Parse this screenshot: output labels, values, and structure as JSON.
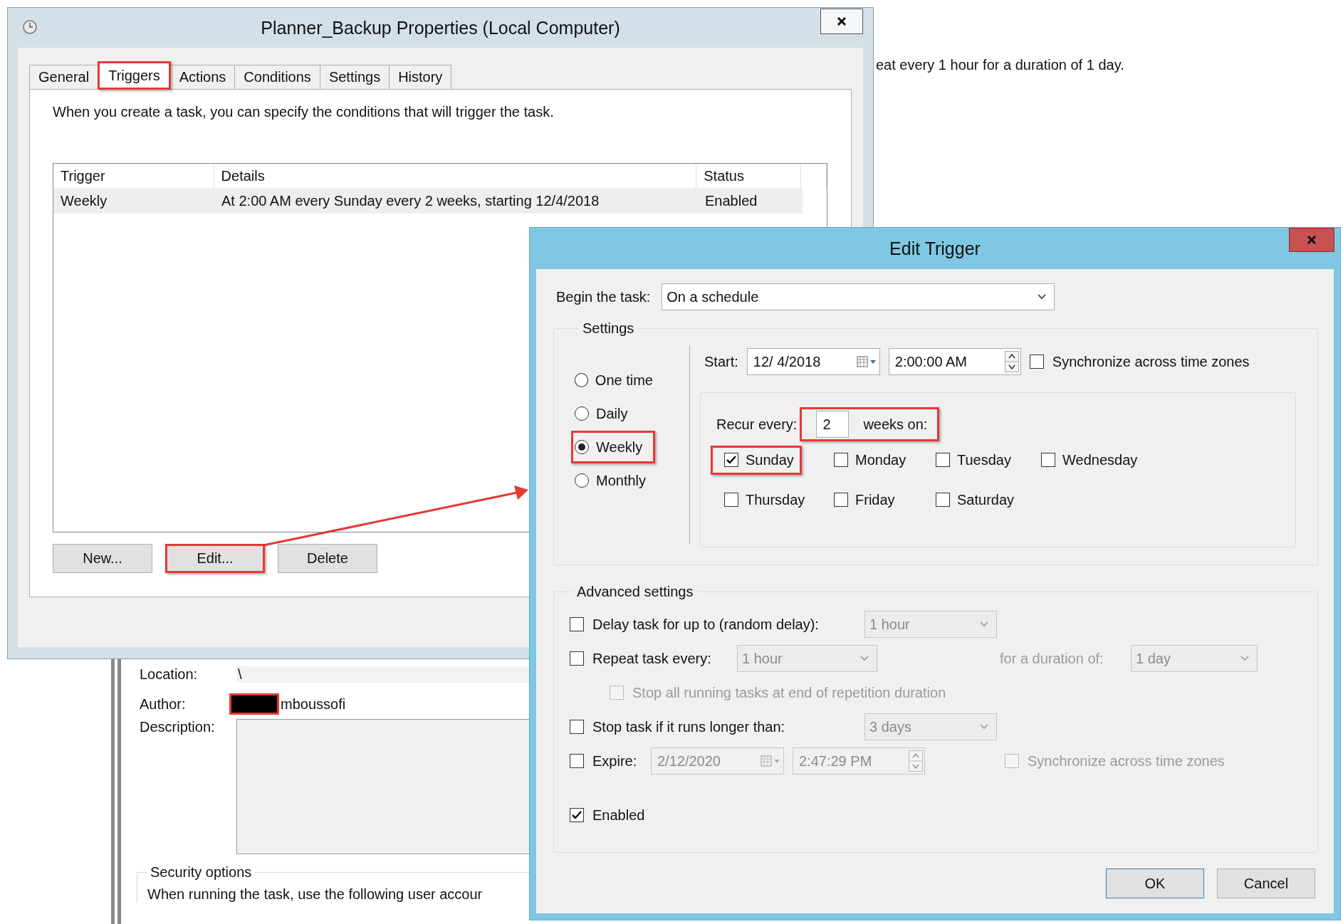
{
  "background_window": {
    "text": "eat every 1 hour for a duration of 1 day."
  },
  "properties_window": {
    "title": "Planner_Backup Properties (Local Computer)",
    "tabs": [
      {
        "label": "General",
        "selected": false,
        "highlighted": false
      },
      {
        "label": "Triggers",
        "selected": true,
        "highlighted": true
      },
      {
        "label": "Actions",
        "selected": false,
        "highlighted": false
      },
      {
        "label": "Conditions",
        "selected": false,
        "highlighted": false
      },
      {
        "label": "Settings",
        "selected": false,
        "highlighted": false
      },
      {
        "label": "History",
        "selected": false,
        "highlighted": false
      }
    ],
    "intro": "When you create a task, you can specify the conditions that will trigger the task.",
    "table": {
      "columns": [
        "Trigger",
        "Details",
        "Status"
      ],
      "rows": [
        {
          "cells": [
            "Weekly",
            "At 2:00 AM every Sunday every 2 weeks, starting 12/4/2018",
            "Enabled"
          ],
          "selected": true
        }
      ]
    },
    "buttons": [
      {
        "label": "New...",
        "highlighted": false,
        "focused": false
      },
      {
        "label": "Edit...",
        "highlighted": true,
        "focused": true
      },
      {
        "label": "Delete",
        "highlighted": false,
        "focused": false
      }
    ]
  },
  "general_panel": {
    "location_label": "Location:",
    "location": "\\",
    "author_label": "Author:",
    "author": "mboussofi",
    "author_redacted": true,
    "description_label": "Description:",
    "security_title": "Security options",
    "security_text": "When running the task, use the following user accour"
  },
  "edit_trigger": {
    "title": "Edit Trigger",
    "begin_label": "Begin the task:",
    "begin_value": "On a schedule",
    "settings_title": "Settings",
    "frequencies": [
      {
        "label": "One time",
        "selected": false,
        "highlighted": false
      },
      {
        "label": "Daily",
        "selected": false,
        "highlighted": false
      },
      {
        "label": "Weekly",
        "selected": true,
        "highlighted": true
      },
      {
        "label": "Monthly",
        "selected": false,
        "highlighted": false
      }
    ],
    "start_label": "Start:",
    "start_date": "12/ 4/2018",
    "start_time": "2:00:00 AM",
    "sync": {
      "label": "Synchronize across time zones",
      "checked": false
    },
    "recur": {
      "label": "Recur every:",
      "value": "2",
      "unit": "weeks on:",
      "highlighted": true
    },
    "days": [
      {
        "label": "Sunday",
        "checked": true,
        "highlighted": true
      },
      {
        "label": "Monday",
        "checked": false,
        "highlighted": false
      },
      {
        "label": "Tuesday",
        "checked": false,
        "highlighted": false
      },
      {
        "label": "Wednesday",
        "checked": false,
        "highlighted": false
      },
      {
        "label": "Thursday",
        "checked": false,
        "highlighted": false
      },
      {
        "label": "Friday",
        "checked": false,
        "highlighted": false
      },
      {
        "label": "Saturday",
        "checked": false,
        "highlighted": false
      }
    ],
    "advanced_title": "Advanced settings",
    "delay": {
      "label": "Delay task for up to (random delay):",
      "checked": false,
      "value": "1 hour"
    },
    "repeat": {
      "label": "Repeat task every:",
      "checked": false,
      "value": "1 hour",
      "duration_label": "for a duration of:",
      "duration_value": "1 day"
    },
    "stop_all": {
      "label": "Stop all running tasks at end of repetition duration",
      "checked": false
    },
    "stop_longer": {
      "label": "Stop task if it runs longer than:",
      "checked": false,
      "value": "3 days"
    },
    "expire": {
      "label": "Expire:",
      "checked": false,
      "date": "2/12/2020",
      "time": "2:47:29 PM",
      "sync_label": "Synchronize across time zones",
      "sync_checked": false
    },
    "enabled": {
      "label": "Enabled",
      "checked": true
    },
    "buttons": [
      {
        "label": "OK",
        "focused": true
      },
      {
        "label": "Cancel",
        "focused": false
      }
    ]
  }
}
